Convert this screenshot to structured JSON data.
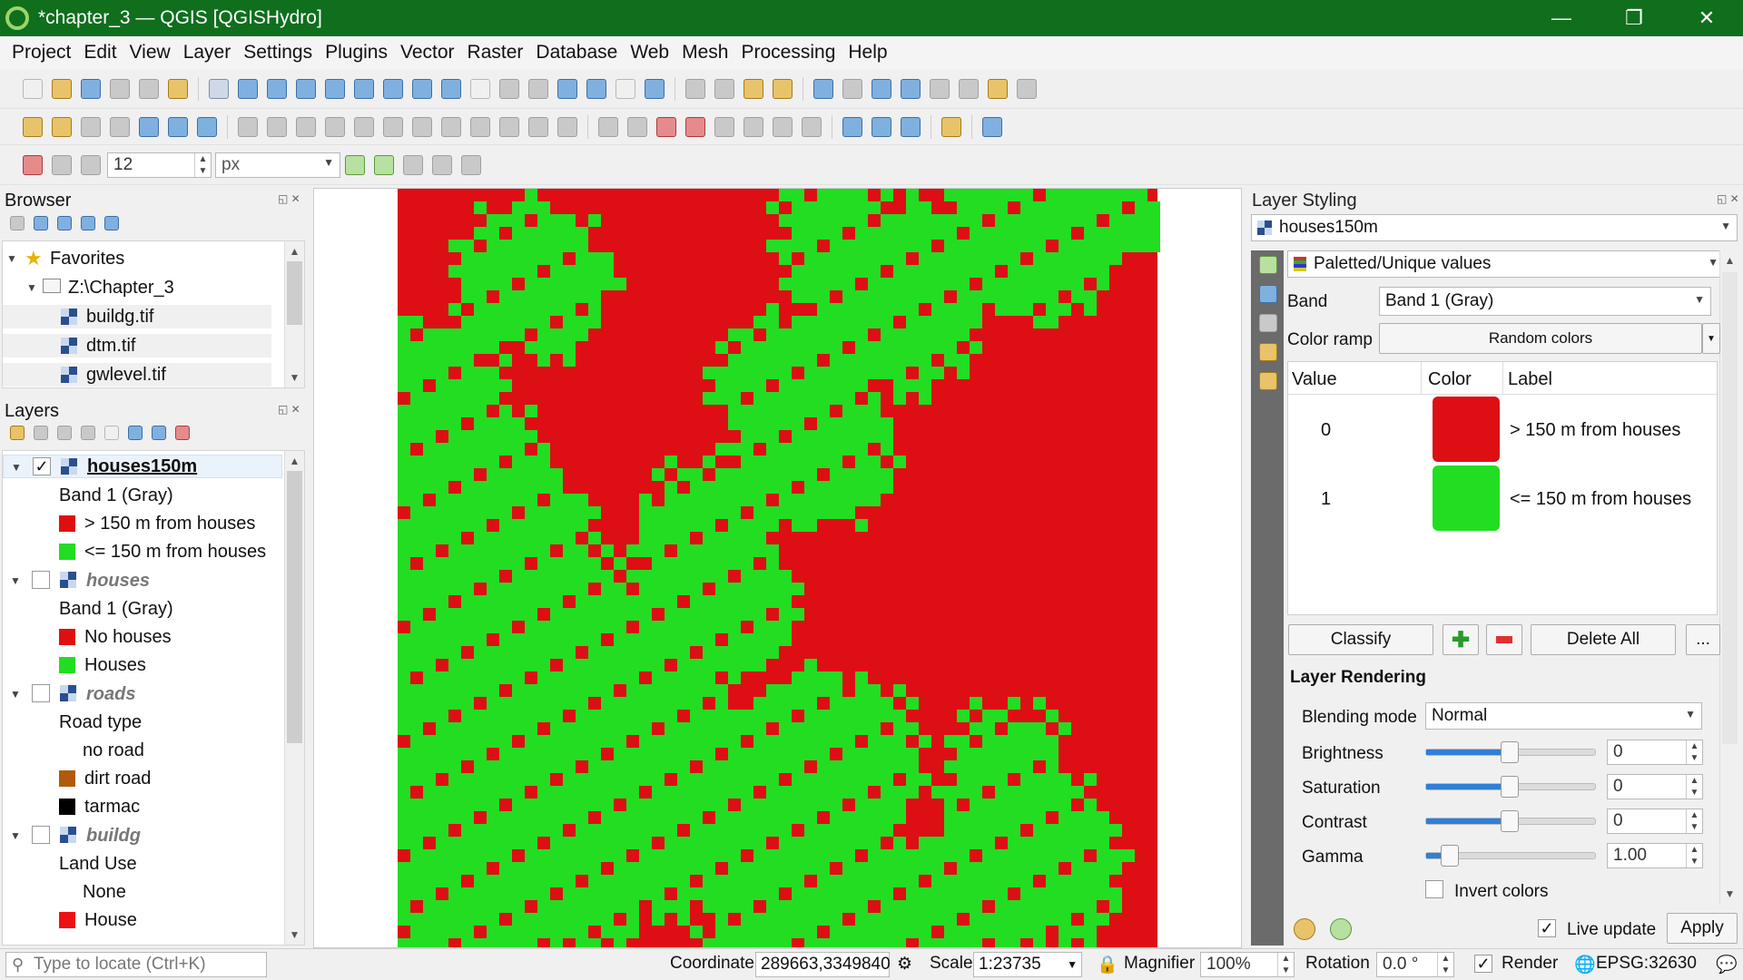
{
  "window": {
    "title": "*chapter_3 — QGIS [QGISHydro]",
    "minimize": "—",
    "restore": "❐",
    "close": "✕"
  },
  "menu": [
    "Project",
    "Edit",
    "View",
    "Layer",
    "Settings",
    "Plugins",
    "Vector",
    "Raster",
    "Database",
    "Web",
    "Mesh",
    "Processing",
    "Help"
  ],
  "snapping": {
    "tolerance": "12",
    "unit": "px"
  },
  "browser": {
    "title": "Browser",
    "items": [
      {
        "label": "Favorites",
        "type": "favorites"
      },
      {
        "label": "Z:\\Chapter_3",
        "type": "folder"
      },
      {
        "label": "buildg.tif",
        "type": "raster"
      },
      {
        "label": "dtm.tif",
        "type": "raster"
      },
      {
        "label": "gwlevel.tif",
        "type": "raster"
      }
    ]
  },
  "layers": {
    "title": "Layers",
    "items": [
      {
        "name": "houses150m",
        "checked": true,
        "band": "Band 1 (Gray)",
        "classes": [
          {
            "label": "> 150 m from houses",
            "color": "#e00f0f"
          },
          {
            "label": "<= 150 m from houses",
            "color": "#22dd22"
          }
        ]
      },
      {
        "name": "houses",
        "checked": false,
        "band": "Band 1 (Gray)",
        "classes": [
          {
            "label": "No houses",
            "color": "#e00f0f"
          },
          {
            "label": "Houses",
            "color": "#22dd22"
          }
        ]
      },
      {
        "name": "roads",
        "checked": false,
        "band": "Road type",
        "classes": [
          {
            "label": "no road",
            "color": ""
          },
          {
            "label": "dirt road",
            "color": "#b05a0a"
          },
          {
            "label": "tarmac",
            "color": "#000000"
          }
        ]
      },
      {
        "name": "buildg",
        "checked": false,
        "band": "Land Use",
        "classes": [
          {
            "label": "None",
            "color": ""
          },
          {
            "label": "House",
            "color": "#ee1111"
          }
        ]
      }
    ]
  },
  "styling": {
    "title": "Layer Styling",
    "layer": "houses150m",
    "renderer": "Paletted/Unique values",
    "band_label": "Band",
    "band": "Band 1 (Gray)",
    "ramp_label": "Color ramp",
    "ramp": "Random colors",
    "table": {
      "headers": [
        "Value",
        "Color",
        "Label"
      ],
      "rows": [
        {
          "value": "0",
          "color": "#dd0f14",
          "label": "> 150 m from houses"
        },
        {
          "value": "1",
          "color": "#22dd22",
          "label": "<= 150 m from houses"
        }
      ]
    },
    "classify": "Classify",
    "delete_all": "Delete All",
    "more": "...",
    "rendering_title": "Layer Rendering",
    "blending_label": "Blending mode",
    "blending": "Normal",
    "sliders": [
      {
        "label": "Brightness",
        "value": "0",
        "level": 0.5
      },
      {
        "label": "Saturation",
        "value": "0",
        "level": 0.5
      },
      {
        "label": "Contrast",
        "value": "0",
        "level": 0.5
      },
      {
        "label": "Gamma",
        "value": "1.00",
        "level": 0.1
      }
    ],
    "invert": "Invert colors",
    "live_update": "Live update",
    "apply": "Apply"
  },
  "status": {
    "locate_placeholder": "Type to locate (Ctrl+K)",
    "coordinate_label": "Coordinate",
    "coordinate": "289663,3349840",
    "scale_label": "Scale",
    "scale": "1:23735",
    "magnifier_label": "Magnifier",
    "magnifier": "100%",
    "rotation_label": "Rotation",
    "rotation": "0.0 °",
    "render": "Render",
    "crs": "EPSG:32630"
  }
}
